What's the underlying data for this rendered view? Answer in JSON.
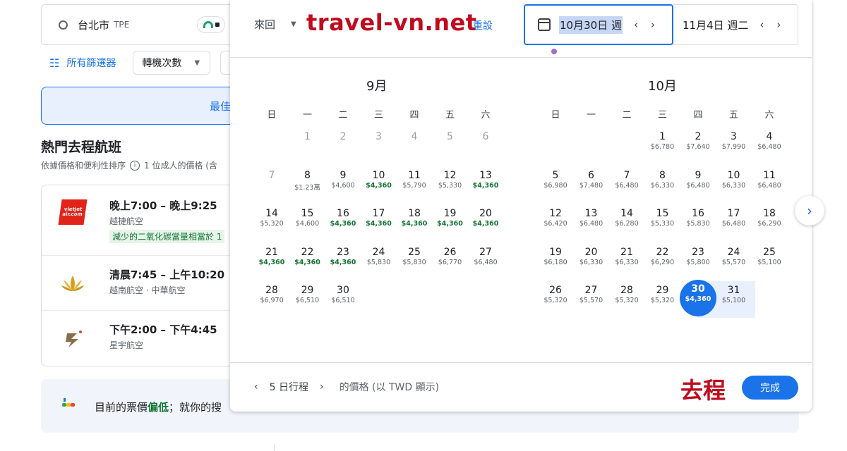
{
  "search": {
    "origin_city": "台北市",
    "origin_code": "TPE"
  },
  "filters": {
    "all_filters": "所有篩選器",
    "stops": "轉機次數"
  },
  "tabs": {
    "best": "最佳"
  },
  "popular": {
    "title": "熱門去程航班",
    "sort_note": "依據價格和便利性排序",
    "price_note": "1 位成人的價格 (含"
  },
  "flights": [
    {
      "time": "晚上7:00 – 晚上9:25",
      "airline": "越捷航空",
      "co2": "減少的二氧化碳當量相當於 1",
      "logo_text": "vietjet air.com"
    },
    {
      "time": "清晨7:45 – 上午10:20",
      "airline": "越南航空 · 中華航空"
    },
    {
      "time": "下午2:00 – 下午4:45",
      "airline": "星宇航空"
    }
  ],
  "price_banner": {
    "prefix": "目前的票價",
    "low": "偏低",
    "suffix": "；就你的搜"
  },
  "calendar": {
    "trip_type": "來回",
    "watermark": "travel-vn.net",
    "reset": "重設",
    "depart_date": "10月30日 週",
    "return_date": "11月4日 週二",
    "weekdays": [
      "日",
      "一",
      "二",
      "三",
      "四",
      "五",
      "六"
    ],
    "months": [
      {
        "title": "9月",
        "rows": [
          [
            null,
            {
              "d": "1",
              "past": true
            },
            {
              "d": "2",
              "past": true
            },
            {
              "d": "3",
              "past": true
            },
            {
              "d": "4",
              "past": true
            },
            {
              "d": "5",
              "past": true
            },
            {
              "d": "6",
              "past": true
            }
          ],
          [
            {
              "d": "7",
              "past": true
            },
            {
              "d": "8",
              "p": "$1.23萬"
            },
            {
              "d": "9",
              "p": "$4,600"
            },
            {
              "d": "10",
              "p": "$4,360",
              "low": true
            },
            {
              "d": "11",
              "p": "$5,790"
            },
            {
              "d": "12",
              "p": "$5,330"
            },
            {
              "d": "13",
              "p": "$4,360",
              "low": true
            }
          ],
          [
            {
              "d": "14",
              "p": "$5,320"
            },
            {
              "d": "15",
              "p": "$4,600"
            },
            {
              "d": "16",
              "p": "$4,360",
              "low": true
            },
            {
              "d": "17",
              "p": "$4,360",
              "low": true
            },
            {
              "d": "18",
              "p": "$4,360",
              "low": true
            },
            {
              "d": "19",
              "p": "$4,360",
              "low": true
            },
            {
              "d": "20",
              "p": "$4,360",
              "low": true
            }
          ],
          [
            {
              "d": "21",
              "p": "$4,360",
              "low": true
            },
            {
              "d": "22",
              "p": "$4,360",
              "low": true
            },
            {
              "d": "23",
              "p": "$4,360",
              "low": true
            },
            {
              "d": "24",
              "p": "$5,830"
            },
            {
              "d": "25",
              "p": "$5,830"
            },
            {
              "d": "26",
              "p": "$6,770"
            },
            {
              "d": "27",
              "p": "$6,480"
            }
          ],
          [
            {
              "d": "28",
              "p": "$6,970"
            },
            {
              "d": "29",
              "p": "$6,510"
            },
            {
              "d": "30",
              "p": "$6,510"
            },
            null,
            null,
            null,
            null
          ]
        ]
      },
      {
        "title": "10月",
        "rows": [
          [
            null,
            null,
            null,
            {
              "d": "1",
              "p": "$6,780"
            },
            {
              "d": "2",
              "p": "$7,640"
            },
            {
              "d": "3",
              "p": "$7,990"
            },
            {
              "d": "4",
              "p": "$6,480"
            }
          ],
          [
            {
              "d": "5",
              "p": "$6,980"
            },
            {
              "d": "6",
              "p": "$7,480"
            },
            {
              "d": "7",
              "p": "$6,480"
            },
            {
              "d": "8",
              "p": "$6,330"
            },
            {
              "d": "9",
              "p": "$6,480"
            },
            {
              "d": "10",
              "p": "$6,330"
            },
            {
              "d": "11",
              "p": "$6,480"
            }
          ],
          [
            {
              "d": "12",
              "p": "$6,420"
            },
            {
              "d": "13",
              "p": "$6,480"
            },
            {
              "d": "14",
              "p": "$6,280"
            },
            {
              "d": "15",
              "p": "$5,330"
            },
            {
              "d": "16",
              "p": "$5,830"
            },
            {
              "d": "17",
              "p": "$6,480"
            },
            {
              "d": "18",
              "p": "$6,290"
            }
          ],
          [
            {
              "d": "19",
              "p": "$6,180"
            },
            {
              "d": "20",
              "p": "$6,330"
            },
            {
              "d": "21",
              "p": "$6,330"
            },
            {
              "d": "22",
              "p": "$6,290"
            },
            {
              "d": "23",
              "p": "$5,800"
            },
            {
              "d": "24",
              "p": "$5,570"
            },
            {
              "d": "25",
              "p": "$5,100"
            }
          ],
          [
            {
              "d": "26",
              "p": "$5,320"
            },
            {
              "d": "27",
              "p": "$5,570"
            },
            {
              "d": "28",
              "p": "$5,320"
            },
            {
              "d": "29",
              "p": "$5,320"
            },
            {
              "d": "30",
              "p": "$4,360",
              "sel": true
            },
            {
              "d": "31",
              "p": "$5,100"
            },
            null
          ]
        ]
      }
    ],
    "trip_length": "5 日行程",
    "price_note": "的價格 (以 TWD 顯示)",
    "outbound_label": "去程",
    "done": "完成"
  },
  "colors": {
    "accent": "#1a73e8",
    "low_price": "#137333",
    "watermark": "#c00a1d"
  }
}
